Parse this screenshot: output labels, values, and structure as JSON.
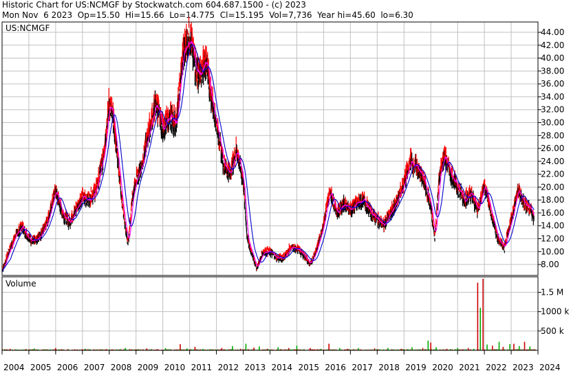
{
  "header": {
    "line1": "Historic Chart for US:NCMGF by Stockwatch.com 604.687.1500 - (c) 2023",
    "line2": "Mon Nov  6 2023  Op=15.50  Hi=15.66  Lo=14.775  Cl=15.195  Vol=7,736  Year hi=45.60  lo=6.30"
  },
  "colors": {
    "price_up": "#ff0000",
    "price_down": "#000000",
    "ma_short": "#ff00ff",
    "ma_long": "#0000cc",
    "volume_up": "#00aa00",
    "volume_down": "#cc0000",
    "grid": "#c0c0c0"
  },
  "chart_data": [
    {
      "type": "line",
      "title": "US:NCMGF",
      "ylim": [
        6.3,
        45.6
      ],
      "y_ticks": [
        "44.00",
        "42.00",
        "40.00",
        "38.00",
        "36.00",
        "34.00",
        "32.00",
        "30.00",
        "28.00",
        "26.00",
        "24.00",
        "22.00",
        "20.00",
        "18.00",
        "16.00",
        "14.00",
        "12.00",
        "10.00",
        "8.00"
      ],
      "x_ticks": [
        "2004",
        "2005",
        "2006",
        "2007",
        "2008",
        "2009",
        "2010",
        "2011",
        "2012",
        "2013",
        "2014",
        "2015",
        "2016",
        "2017",
        "2018",
        "2019",
        "2020",
        "2021",
        "2022",
        "2023",
        "2024"
      ],
      "series": [
        {
          "x": [
            2004.0,
            2004.25,
            2004.5,
            2004.75,
            2005.0,
            2005.25,
            2005.5,
            2005.75,
            2006.0,
            2006.25,
            2006.5,
            2006.75,
            2007.0,
            2007.25,
            2007.5,
            2007.75,
            2008.0,
            2008.15,
            2008.3,
            2008.5,
            2008.7,
            2008.85,
            2009.0,
            2009.25,
            2009.5,
            2009.75,
            2010.0,
            2010.25,
            2010.5,
            2010.75,
            2011.0,
            2011.2,
            2011.4,
            2011.6,
            2011.8,
            2012.0,
            2012.25,
            2012.5,
            2012.75,
            2013.0,
            2013.15,
            2013.3,
            2013.5,
            2013.75,
            2014.0,
            2014.25,
            2014.5,
            2014.75,
            2015.0,
            2015.25,
            2015.5,
            2015.75,
            2016.0,
            2016.25,
            2016.5,
            2016.75,
            2017.0,
            2017.25,
            2017.5,
            2017.75,
            2018.0,
            2018.25,
            2018.5,
            2018.75,
            2019.0,
            2019.25,
            2019.5,
            2019.75,
            2020.0,
            2020.15,
            2020.3,
            2020.5,
            2020.75,
            2021.0,
            2021.25,
            2021.5,
            2021.75,
            2022.0,
            2022.25,
            2022.5,
            2022.75,
            2023.0,
            2023.25,
            2023.5,
            2023.75,
            2023.85
          ],
          "values": [
            7.0,
            10.0,
            12.5,
            14.0,
            12.0,
            11.5,
            13.0,
            15.5,
            19.5,
            16.0,
            14.5,
            16.5,
            18.5,
            18.0,
            19.5,
            24.0,
            33.0,
            30.5,
            25.0,
            17.0,
            11.0,
            18.0,
            21.0,
            24.0,
            29.0,
            33.0,
            29.0,
            31.0,
            30.0,
            40.5,
            43.5,
            39.0,
            37.0,
            40.0,
            34.0,
            30.0,
            24.0,
            22.0,
            26.0,
            21.0,
            12.0,
            10.0,
            7.5,
            10.0,
            10.0,
            9.0,
            9.0,
            10.5,
            10.5,
            9.5,
            8.0,
            10.5,
            14.5,
            19.5,
            16.0,
            17.5,
            16.5,
            17.5,
            18.0,
            16.0,
            15.0,
            14.0,
            16.0,
            18.0,
            20.5,
            24.0,
            23.0,
            21.0,
            17.0,
            12.0,
            21.0,
            25.0,
            22.0,
            20.0,
            18.0,
            19.0,
            16.5,
            20.5,
            16.0,
            12.0,
            10.5,
            15.0,
            19.5,
            17.5,
            16.5,
            15.0
          ]
        }
      ]
    },
    {
      "type": "bar",
      "title": "Volume",
      "y_ticks": [
        "1.5 M",
        "1000 k",
        "500 k"
      ],
      "ylim": [
        0,
        1900000
      ],
      "x_ticks": [
        "2004",
        "2005",
        "2006",
        "2007",
        "2008",
        "2009",
        "2010",
        "2011",
        "2012",
        "2013",
        "2014",
        "2015",
        "2016",
        "2017",
        "2018",
        "2019",
        "2020",
        "2021",
        "2022",
        "2023",
        "2024"
      ],
      "series": [
        {
          "x": [
            2004.3,
            2005.2,
            2006.0,
            2007.1,
            2007.9,
            2008.6,
            2009.4,
            2010.1,
            2010.65,
            2010.9,
            2011.2,
            2011.5,
            2012.2,
            2012.6,
            2012.9,
            2013.1,
            2013.4,
            2013.6,
            2013.9,
            2014.3,
            2014.7,
            2015.0,
            2015.5,
            2015.9,
            2016.2,
            2016.6,
            2016.9,
            2017.3,
            2017.9,
            2018.4,
            2018.9,
            2019.3,
            2019.7,
            2019.9,
            2020.0,
            2020.2,
            2020.6,
            2021.0,
            2021.4,
            2021.6,
            2021.75,
            2021.85,
            2021.95,
            2022.1,
            2022.3,
            2022.55,
            2022.7,
            2022.95,
            2023.1,
            2023.3,
            2023.5,
            2023.7
          ],
          "values": [
            40000,
            50000,
            60000,
            40000,
            30000,
            60000,
            50000,
            60000,
            160000,
            50000,
            90000,
            40000,
            60000,
            110000,
            40000,
            170000,
            70000,
            100000,
            40000,
            80000,
            60000,
            120000,
            60000,
            40000,
            170000,
            60000,
            40000,
            60000,
            50000,
            60000,
            40000,
            80000,
            60000,
            250000,
            200000,
            80000,
            40000,
            60000,
            60000,
            40000,
            1750000,
            1100000,
            1850000,
            150000,
            120000,
            220000,
            90000,
            160000,
            170000,
            110000,
            220000,
            100000
          ]
        }
      ]
    }
  ]
}
